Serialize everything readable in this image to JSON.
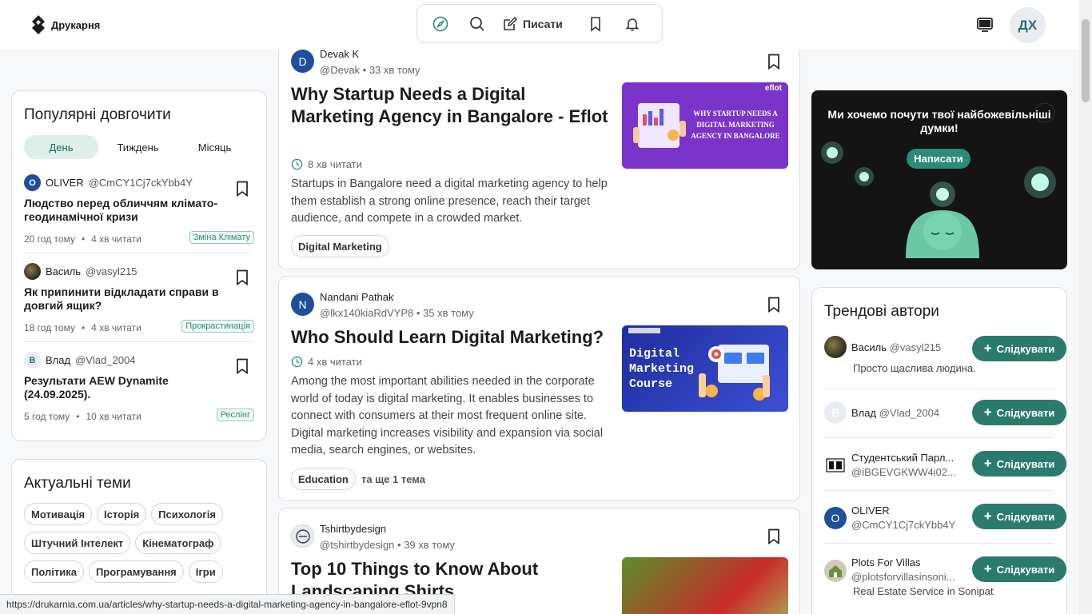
{
  "header": {
    "logo_text": "Друкарня",
    "nav_write_label": "Писати",
    "avatar_initials": "ДХ"
  },
  "popular": {
    "title": "Популярні довгочити",
    "tabs": [
      "День",
      "Тиждень",
      "Місяць"
    ],
    "items": [
      {
        "avatar": "O",
        "name": "OLIVER",
        "handle": "@CmCY1Cj7ckYbb4Y",
        "title": "Людство перед обличчям клімато-геодинамічної кризи",
        "time": "20 год тому",
        "read": "4 хв читати",
        "tag": "Зміна Клімату"
      },
      {
        "avatar": "",
        "name": "Василь",
        "handle": "@vasyl215",
        "title": "Як припинити відкладати справи в довгий ящик?",
        "time": "18 год тому",
        "read": "4 хв читати",
        "tag": "Прокрастинація"
      },
      {
        "avatar": "В",
        "name": "Влад",
        "handle": "@Vlad_2004",
        "title": "Результати AEW Dynamite (24.09.2025).",
        "time": "5 год тому",
        "read": "10 хв читати",
        "tag": "Реслінг"
      }
    ]
  },
  "topics": {
    "title": "Актуальні теми",
    "items": [
      "Мотивація",
      "Історія",
      "Психологія",
      "Штучний Інтелект",
      "Кінематограф",
      "Політика",
      "Програмування",
      "Ігри"
    ]
  },
  "feed": [
    {
      "avatar": "D",
      "author": "Devak K",
      "handle": "@Devak",
      "ago": "33 хв тому",
      "title": "Why Startup Needs a Digital Marketing Agency in Bangalore - Eflot",
      "read": "8 хв читати",
      "desc": "Startups in Bangalore need a digital marketing agency to help them establish a strong online presence, reach their target audience, and compete in a crowded market.",
      "tag": "Digital Marketing",
      "image_caption": "WHY STARTUP NEEDS A DIGITAL MARKETING AGENCY IN BANGALORE",
      "image_brand": "eflot"
    },
    {
      "avatar": "N",
      "author": "Nandani Pathak",
      "handle": "@lkx140kiaRdVYP8",
      "ago": "35 хв тому",
      "title": "Who Should Learn Digital Marketing?",
      "read": "4 хв читати",
      "desc": "Among the most important abilities needed in the corporate world of today is digital marketing. It enables businesses to connect with consumers at their most frequent online site. Digital marketing increases visibility and expansion via social media, search engines, or websites.",
      "tag": "Education",
      "more": "та ще 1 тема",
      "image_caption": "Digital Marketing Course"
    },
    {
      "avatar": "",
      "author": "Tshirtbydesign",
      "handle": "@tshirtbydesign",
      "ago": "39 хв тому",
      "title": "Top 10 Things to Know About Landscaping Shirts"
    }
  ],
  "promo": {
    "text": "Ми хочемо почути твої найбожевільніші думки!",
    "button": "Написати"
  },
  "trending": {
    "title": "Трендові автори",
    "follow_label": "Слідкувати",
    "items": [
      {
        "avatar": "",
        "name": "Василь",
        "handle": "@vasyl215",
        "bio": "Просто щаслива людина."
      },
      {
        "avatar": "В",
        "name": "Влад",
        "handle": "@Vlad_2004",
        "bio": ""
      },
      {
        "avatar": "",
        "name": "Студентський Парл...",
        "handle": "@iBGEVGKWW4i02...",
        "bio": ""
      },
      {
        "avatar": "O",
        "name": "OLIVER",
        "handle": "@CmCY1Cj7ckYbb4Y",
        "bio": ""
      },
      {
        "avatar": "",
        "name": "Plots For Villas",
        "handle": "@plotsforvillasinsoni...",
        "bio": "Real Estate Service in Sonipat"
      }
    ]
  },
  "status_url": "https://drukarnia.com.ua/articles/why-startup-needs-a-digital-marketing-agency-in-bangalore-eflot-9vpn8",
  "colors": {
    "accent": "#2b7a6e",
    "accent_light": "#dcefe9",
    "avatar_blue": "#1f4f9a"
  }
}
